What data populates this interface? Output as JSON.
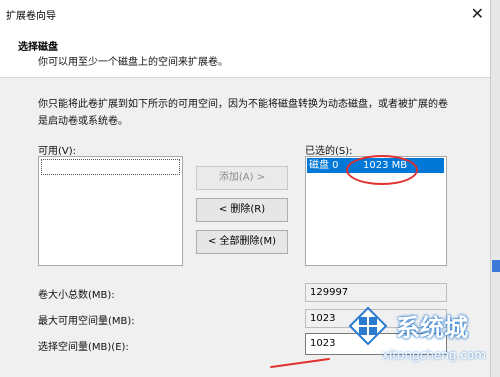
{
  "window": {
    "title": "扩展卷向导"
  },
  "header": {
    "title": "选择磁盘",
    "subtitle": "你可以用至少一个磁盘上的空间来扩展卷。"
  },
  "description": {
    "line1": "你只能将此卷扩展到如下所示的可用空间，因为不能将磁盘转换为动态磁盘，或者被扩展的卷",
    "line2": "是启动卷或系统卷。"
  },
  "available": {
    "label": "可用(V):"
  },
  "selected": {
    "label": "已选的(S):",
    "items": [
      {
        "disk": "磁盘 0",
        "size": "1023 MB"
      }
    ]
  },
  "buttons": {
    "add": "添加(A) >",
    "remove": "< 删除(R)",
    "remove_all": "< 全部删除(M)"
  },
  "fields": {
    "total_label": "卷大小总数(MB):",
    "total_value": "129997",
    "max_label": "最大可用空间量(MB):",
    "max_value": "1023",
    "select_label": "选择空间量(MB)(E):",
    "select_value": "1023"
  },
  "watermark": {
    "brand": "系统城",
    "url": "xitongcheng.com"
  },
  "colors": {
    "selection": "#0078d7",
    "annotation_circle": "#e03030"
  }
}
